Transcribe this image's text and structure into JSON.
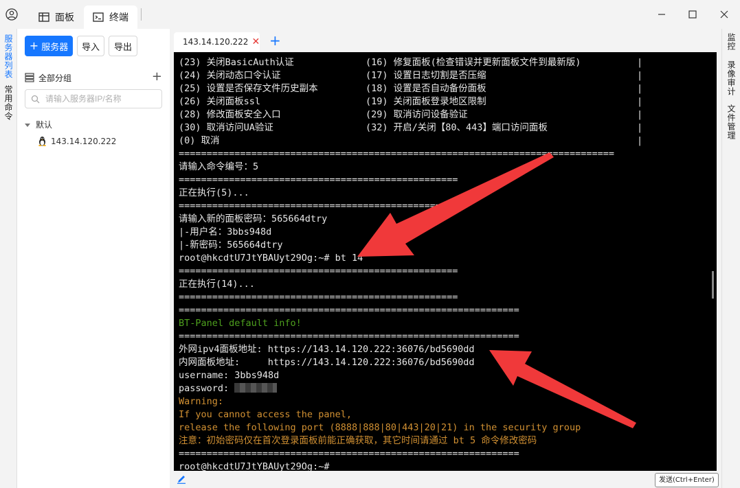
{
  "titlebar": {
    "tabs": [
      {
        "label": "面板",
        "icon": "table-icon"
      },
      {
        "label": "终端",
        "icon": "terminal-icon"
      }
    ],
    "window_controls": [
      "minimize",
      "maximize",
      "close"
    ]
  },
  "left_strip": {
    "items": [
      "服务器列表",
      "常用命令"
    ]
  },
  "server_panel": {
    "add_server_label": "服务器",
    "import_label": "导入",
    "export_label": "导出",
    "group_header": "全部分组",
    "search_placeholder": "请输入服务器IP/名称",
    "groups": [
      {
        "name": "默认",
        "servers": [
          "143.14.120.222"
        ]
      }
    ]
  },
  "terminal_tab": {
    "title": "143.14.120.222",
    "status_color": "#21b33b",
    "close_color": "#e53935"
  },
  "terminal": {
    "menu_rows": [
      {
        "left": "(23) 关闭BasicAuth认证",
        "right": "(16) 修复面板(检查错误并更新面板文件到最新版)"
      },
      {
        "left": "(24) 关闭动态口令认证",
        "right": "(17) 设置日志切割是否压缩"
      },
      {
        "left": "(25) 设置是否保存文件历史副本",
        "right": "(18) 设置是否自动备份面板"
      },
      {
        "left": "(26) 关闭面板ssl",
        "right": "(19) 关闭面板登录地区限制"
      },
      {
        "left": "(28) 修改面板安全入口",
        "right": "(29) 取消访问设备验证"
      },
      {
        "left": "(30) 取消访问UA验证",
        "right": "(32) 开启/关闭【80、443】端口访问面板"
      },
      {
        "left": "(0) 取消",
        "right": ""
      }
    ],
    "menu_border": "|",
    "separator_long": "==============================================================================",
    "separator_short": "==================================================",
    "separator_mid": "=============================================================",
    "prompt_cmd_label": "请输入命令编号：5",
    "executing_5": "正在执行(5)...",
    "new_pwd_line": "请输入新的面板密码：565664dtry",
    "username_line": "|-用户名：3bbs948d",
    "newpwd_line": "|-新密码：565664dtry",
    "cmd_line": "root@hkcdtU7JtYBAUyt29Og:~# bt 14",
    "executing_14": "正在执行(14)...",
    "bt_info_title": "BT-Panel default info!",
    "ext_addr_label": "外网ipv4面板地址: ",
    "ext_addr": "https://143.14.120.222:36076/bd5690dd",
    "int_addr_label": "内网面板地址:     ",
    "int_addr": "https://143.14.120.222:36076/bd5690dd",
    "username": "username: 3bbs948d",
    "password_label": "password: ",
    "warning": "Warning:",
    "warn_line1": "If you cannot access the panel,",
    "warn_line2": "release the following port (8888|888|80|443|20|21) in the security group",
    "warn_line3": "注意：初始密码仅在首次登录面板前能正确获取，其它时间请通过 bt 5 命令修改密码",
    "final_prompt": "root@hkcdtU7JtYBAUyt29Og:~#"
  },
  "bottombar": {
    "send_label": "发送(Ctrl+Enter)"
  },
  "right_strip": {
    "items": [
      "监控",
      "录像审计",
      "文件管理"
    ]
  },
  "colors": {
    "accent": "#1677ff",
    "annotation_arrow": "#f0393a",
    "terminal_bg": "#000000",
    "terminal_green": "#4ea01e",
    "terminal_orange": "#d19032"
  }
}
